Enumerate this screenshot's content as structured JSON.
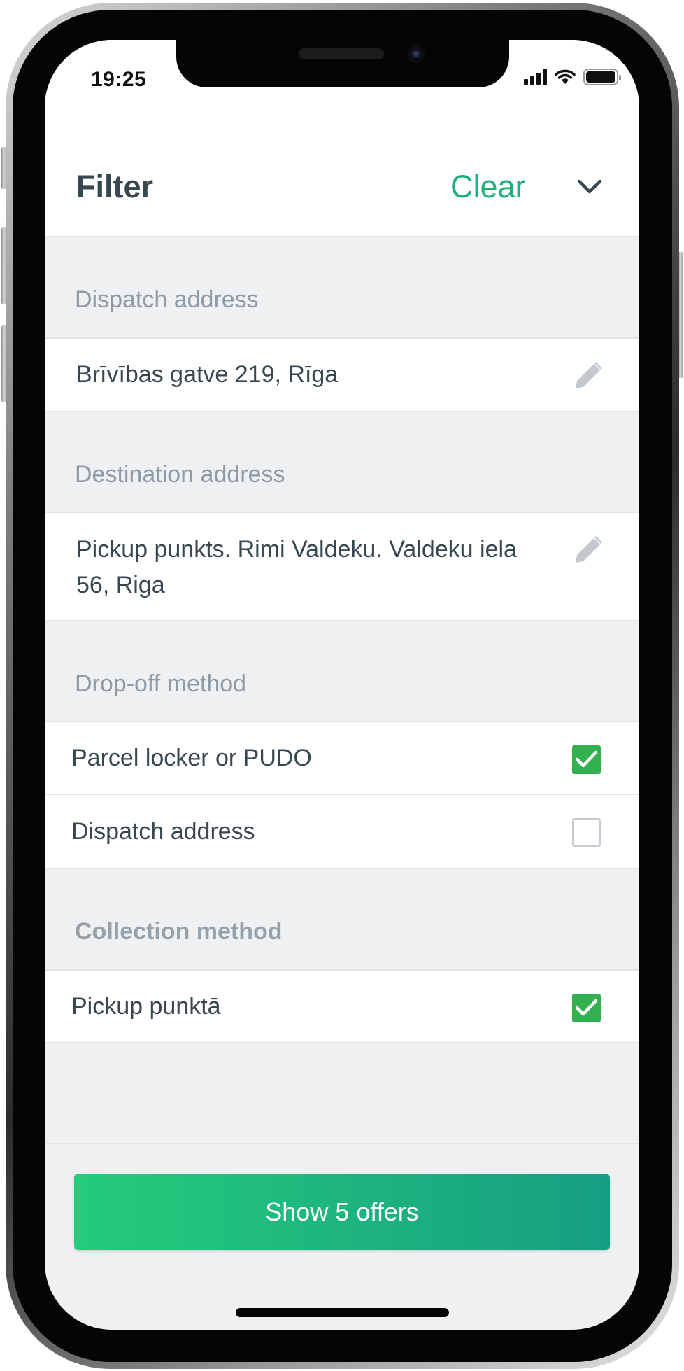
{
  "status_bar": {
    "time": "19:25"
  },
  "header": {
    "title": "Filter",
    "clear_label": "Clear",
    "collapse_icon": "chevron-down-icon"
  },
  "dispatch": {
    "label": "Dispatch address",
    "value": "Brīvības gatve 219, Rīga",
    "edit_icon": "pencil-icon"
  },
  "destination": {
    "label": "Destination address",
    "value": "Pickup punkts. Rimi Valdeku. Valdeku iela 56, Riga",
    "edit_icon": "pencil-icon"
  },
  "dropoff": {
    "label": "Drop-off method",
    "options": [
      {
        "label": "Parcel locker or PUDO",
        "checked": true
      },
      {
        "label": "Dispatch address",
        "checked": false
      }
    ]
  },
  "collection": {
    "label": "Collection method",
    "options": [
      {
        "label": "Pickup punktā",
        "checked": true
      }
    ]
  },
  "cta": {
    "label": "Show 5 offers"
  },
  "colors": {
    "accent": "#1fb07a",
    "check": "#34b14f",
    "cta_start": "#25cc7b",
    "cta_end": "#169e82",
    "text": "#37474f",
    "section_label": "#8d9ba6"
  }
}
